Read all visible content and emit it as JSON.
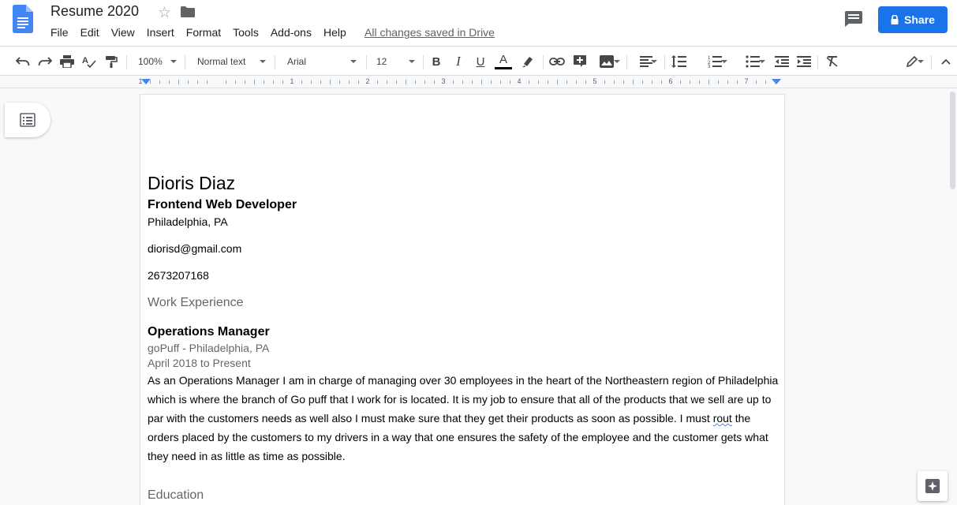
{
  "app": {
    "doc_title": "Resume 2020",
    "saved_status": "All changes saved in Drive",
    "share_label": "Share"
  },
  "menu": [
    "File",
    "Edit",
    "View",
    "Insert",
    "Format",
    "Tools",
    "Add-ons",
    "Help"
  ],
  "toolbar": {
    "zoom": "100%",
    "style": "Normal text",
    "font": "Arial",
    "font_size": "12",
    "icons": [
      "undo-icon",
      "redo-icon",
      "print-icon",
      "spellcheck-icon",
      "paint-format-icon",
      "bold-icon",
      "italic-icon",
      "underline-icon",
      "text-color-icon",
      "highlight-icon",
      "link-icon",
      "comment-add-icon",
      "image-icon",
      "align-icon",
      "line-spacing-icon",
      "numbered-list-icon",
      "bulleted-list-icon",
      "decrease-indent-icon",
      "increase-indent-icon",
      "clear-formatting-icon",
      "editing-mode-icon",
      "collapse-icon"
    ],
    "bold_glyph": "B",
    "italic_glyph": "I",
    "underline_glyph": "U",
    "textcolor_glyph": "A"
  },
  "ruler": {
    "numbers": [
      "1",
      "1",
      "2",
      "3",
      "4",
      "5",
      "6",
      "7"
    ]
  },
  "document": {
    "name": "Dioris Diaz",
    "headline": "Frontend Web Developer",
    "location": "Philadelphia, PA",
    "email": "diorisd@gmail.com",
    "phone": "2673207168",
    "work_heading": "Work Experience",
    "job_title": "Operations Manager",
    "company": "goPuff - Philadelphia, PA",
    "dates": "April 2018 to Present",
    "description_start": "As an Operations Manager I am in charge of managing over 30 employees in the heart of the Northeastern region of Philadelphia which is where the branch of Go puff that I work for is located. It is my job to ensure that all of the products that we sell are up to par with the customers needs as well also I must make sure that they get their products as soon as possible. I must ",
    "description_misspelled": "rout",
    "description_end": " the orders placed by the customers to my drivers in a way that one ensures the safety of the employee and the customer gets what they need in as little as time as possible.",
    "education_heading": "Education"
  },
  "colors": {
    "brand_blue": "#1a73e8",
    "docs_blue": "#4285f4"
  }
}
